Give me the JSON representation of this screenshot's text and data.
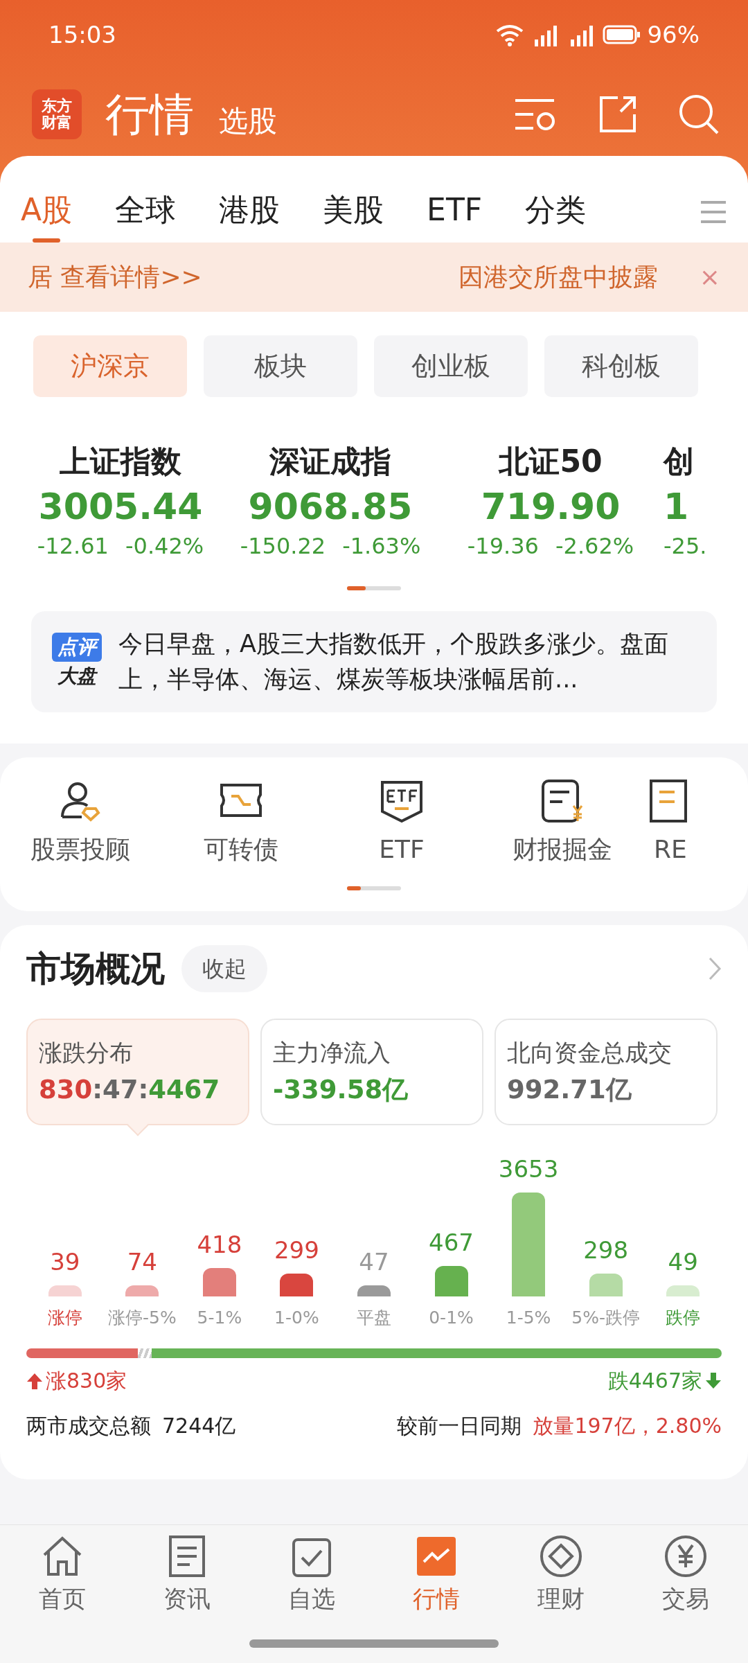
{
  "status_bar": {
    "time": "15:03",
    "battery": "96%"
  },
  "header": {
    "logo": [
      "东方",
      "财富"
    ],
    "title": "行情",
    "subtitle": "选股"
  },
  "tabs": [
    {
      "label": "A股",
      "selected": true
    },
    {
      "label": "全球",
      "selected": false
    },
    {
      "label": "港股",
      "selected": false
    },
    {
      "label": "美股",
      "selected": false
    },
    {
      "label": "ETF",
      "selected": false
    },
    {
      "label": "分类",
      "selected": false
    }
  ],
  "banner": {
    "left_text": "居 查看详情>>",
    "right_text": "因港交所盘中披露",
    "close": "×"
  },
  "chips": [
    {
      "label": "沪深京",
      "selected": true
    },
    {
      "label": "板块",
      "selected": false
    },
    {
      "label": "创业板",
      "selected": false
    },
    {
      "label": "科创板",
      "selected": false
    }
  ],
  "indices": [
    {
      "name": "上证指数",
      "value": "3005.44",
      "change": "-12.61",
      "percent": "-0.42%"
    },
    {
      "name": "深证成指",
      "value": "9068.85",
      "change": "-150.22",
      "percent": "-1.63%"
    },
    {
      "name": "北证50",
      "value": "719.90",
      "change": "-19.36",
      "percent": "-2.62%"
    },
    {
      "name": "创",
      "value": "1",
      "change": "-25."
    }
  ],
  "index_pager": {
    "level": 0.35
  },
  "comment": {
    "badge": [
      "点评",
      "大盘"
    ],
    "text": "今日早盘，A股三大指数低开，个股跌多涨少。盘面上，半导体、海运、煤炭等板块涨幅居前..."
  },
  "shortcuts": [
    {
      "label": "股票投顾",
      "kind": "advisor"
    },
    {
      "label": "可转债",
      "kind": "ticket"
    },
    {
      "label": "ETF",
      "kind": "etf"
    },
    {
      "label": "财报掘金",
      "kind": "report"
    },
    {
      "label": "RE",
      "kind": "list"
    }
  ],
  "shortcut_pager": {
    "level": 0.25
  },
  "market": {
    "title": "市场概况",
    "collapse": "收起",
    "stats": [
      {
        "label": "涨跌分布",
        "selected": true,
        "parts": [
          {
            "text": "830",
            "color": "#d6403a"
          },
          {
            "text": ":47:",
            "color": "#666666"
          },
          {
            "text": "4467",
            "color": "#3f9a37"
          }
        ]
      },
      {
        "label": "主力净流入",
        "selected": false,
        "parts": [
          {
            "text": "-339.58亿",
            "color": "#3f9a37"
          }
        ]
      },
      {
        "label": "北向资金总成交",
        "selected": false,
        "parts": [
          {
            "text": "992.71亿",
            "color": "#666666"
          }
        ]
      }
    ],
    "distribution": [
      {
        "label": "涨停",
        "count": "39",
        "color": "#f6d3d3",
        "kind": "limit_up"
      },
      {
        "label": "涨停-5%",
        "count": "74",
        "color": "#eeaaaa",
        "kind": "rise"
      },
      {
        "label": "5-1%",
        "count": "418",
        "color": "#e37f7b",
        "kind": "rise"
      },
      {
        "label": "1-0%",
        "count": "299",
        "color": "#d9463f",
        "kind": "rise"
      },
      {
        "label": "平盘",
        "count": "47",
        "color": "#9a9a9a",
        "kind": "flat"
      },
      {
        "label": "0-1%",
        "count": "467",
        "color": "#66b14f",
        "kind": "fall"
      },
      {
        "label": "1-5%",
        "count": "3653",
        "color": "#93c97b",
        "kind": "fall"
      },
      {
        "label": "5%-跌停",
        "count": "298",
        "color": "#b5dba5",
        "kind": "fall"
      },
      {
        "label": "跌停",
        "count": "49",
        "color": "#d8edd0",
        "kind": "limit_down"
      }
    ],
    "ratio": {
      "level": 0.16
    },
    "up_count": "涨830家",
    "down_count": "跌4467家",
    "turnover_label": "两市成交总额",
    "turnover": "7244亿",
    "compare_label": "较前一日同期",
    "compare": "放量197亿，2.80%"
  },
  "bottom_nav": [
    {
      "label": "首页",
      "kind": "home",
      "selected": false
    },
    {
      "label": "资讯",
      "kind": "news",
      "selected": false
    },
    {
      "label": "自选",
      "kind": "watch",
      "selected": false
    },
    {
      "label": "行情",
      "kind": "chart",
      "selected": true
    },
    {
      "label": "理财",
      "kind": "diamond",
      "selected": false
    },
    {
      "label": "交易",
      "kind": "yen",
      "selected": false
    }
  ]
}
